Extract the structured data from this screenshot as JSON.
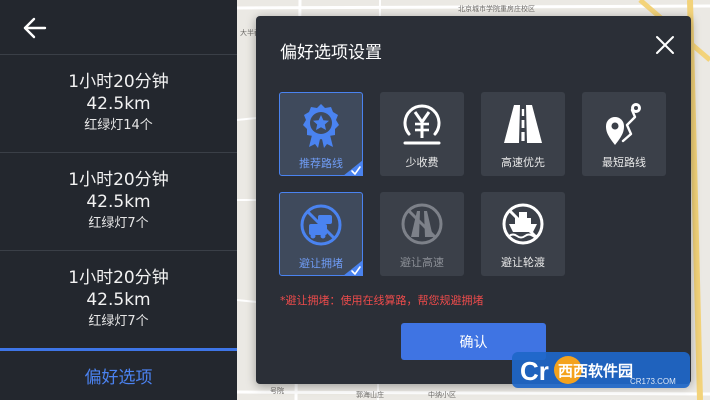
{
  "map": {
    "labels": [
      "北京城市学院重房庄校区",
      "大半截",
      "号院",
      "郭海山庄",
      "中纳小区"
    ]
  },
  "left_panel": {
    "back_icon": "arrow-left-icon",
    "routes": [
      {
        "time": "1小时20分钟",
        "distance": "42.5km",
        "lights": "红绿灯14个"
      },
      {
        "time": "1小时20分钟",
        "distance": "42.5km",
        "lights": "红绿灯7个"
      },
      {
        "time": "1小时20分钟",
        "distance": "42.5km",
        "lights": "红绿灯7个"
      }
    ],
    "preference_tab": "偏好选项"
  },
  "dialog": {
    "title": "偏好选项设置",
    "close_icon": "close-icon",
    "options": [
      {
        "label": "推荐路线",
        "icon": "medal-star-icon",
        "selected": true,
        "disabled": false
      },
      {
        "label": "少收费",
        "icon": "yen-coin-icon",
        "selected": false,
        "disabled": false
      },
      {
        "label": "高速优先",
        "icon": "highway-icon",
        "selected": false,
        "disabled": false
      },
      {
        "label": "最短路线",
        "icon": "route-pin-icon",
        "selected": false,
        "disabled": false
      },
      {
        "label": "避让拥堵",
        "icon": "avoid-traffic-icon",
        "selected": true,
        "disabled": false
      },
      {
        "label": "避让高速",
        "icon": "avoid-highway-icon",
        "selected": false,
        "disabled": true
      },
      {
        "label": "避让轮渡",
        "icon": "avoid-ferry-icon",
        "selected": false,
        "disabled": false
      }
    ],
    "hint": "*避让拥堵：使用在线算路，帮您规避拥堵",
    "confirm_label": "确认"
  },
  "watermark": {
    "text": "西西软件园",
    "subtext": "CR173.COM"
  },
  "colors": {
    "panel_bg": "#23272e",
    "dialog_bg": "#2b2f37",
    "option_bg": "#3b4049",
    "accent": "#3f74e3",
    "hint_red": "#ec4b4b"
  }
}
